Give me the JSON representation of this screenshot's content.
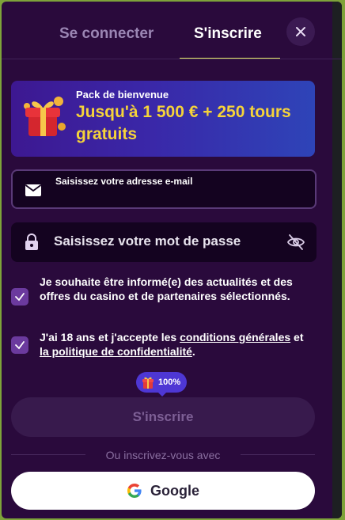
{
  "tabs": {
    "login_label": "Se connecter",
    "register_label": "S'inscrire"
  },
  "promo": {
    "subtitle": "Pack de bienvenue",
    "title": "Jusqu'à 1 500 € + 250 tours gratuits"
  },
  "form": {
    "email_label": "Saisissez votre adresse e-mail",
    "password_placeholder": "Saisissez votre mot de passe"
  },
  "consents": {
    "news_text": "Je souhaite être informé(e) des actualités et des offres du casino et de partenaires sélectionnés.",
    "news_checked": true,
    "terms_prefix": "J'ai 18 ans et j'accepte les ",
    "terms_link": "conditions générales",
    "terms_middle": " et ",
    "privacy_link": "la politique de confidentialité",
    "terms_suffix": ".",
    "terms_checked": true
  },
  "bonus_badge": "100%",
  "submit_label": "S'inscrire",
  "divider_text": "Ou inscrivez-vous avec",
  "google_label": "Google",
  "colors": {
    "background": "#2a0a3c",
    "accent_underline": "#e7ef6a",
    "promo_title": "#f5d33a",
    "checkbox": "#6b3a9e",
    "badge": "#4e37d4"
  },
  "icons": [
    "close-icon",
    "gift-box-icon",
    "envelope-icon",
    "lock-icon",
    "eye-off-icon",
    "check-icon",
    "google-icon"
  ]
}
